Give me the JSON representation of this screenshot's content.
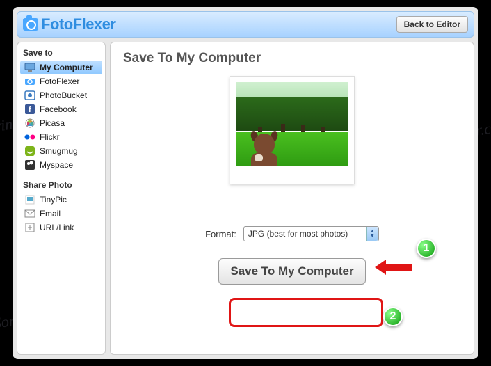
{
  "header": {
    "brand": "FotoFlexer",
    "back_label": "Back to Editor"
  },
  "sidebar": {
    "save_heading": "Save to",
    "share_heading": "Share Photo",
    "save_items": [
      {
        "label": "My Computer",
        "icon": "monitor-icon",
        "selected": true
      },
      {
        "label": "FotoFlexer",
        "icon": "camera-icon",
        "selected": false
      },
      {
        "label": "PhotoBucket",
        "icon": "photobucket-icon",
        "selected": false
      },
      {
        "label": "Facebook",
        "icon": "facebook-icon",
        "selected": false
      },
      {
        "label": "Picasa",
        "icon": "picasa-icon",
        "selected": false
      },
      {
        "label": "Flickr",
        "icon": "flickr-icon",
        "selected": false
      },
      {
        "label": "Smugmug",
        "icon": "smugmug-icon",
        "selected": false
      },
      {
        "label": "Myspace",
        "icon": "myspace-icon",
        "selected": false
      }
    ],
    "share_items": [
      {
        "label": "TinyPic",
        "icon": "tinypic-icon"
      },
      {
        "label": "Email",
        "icon": "email-icon"
      },
      {
        "label": "URL/Link",
        "icon": "link-icon"
      }
    ]
  },
  "main": {
    "title": "Save To My Computer",
    "format_label": "Format:",
    "format_value": "JPG (best for most photos)",
    "save_button": "Save To My Computer"
  },
  "annotations": {
    "callout1": "1",
    "callout2": "2"
  },
  "watermark_text": "Soringpcrepair.com"
}
